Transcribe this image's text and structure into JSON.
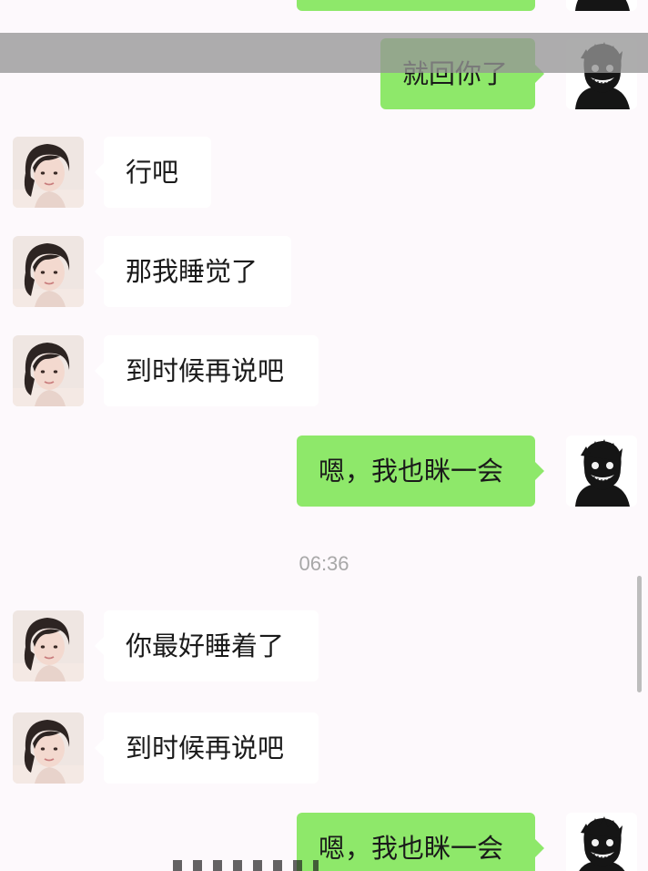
{
  "colors": {
    "background": "#fdf9fc",
    "outgoing_bubble": "#8ee86a",
    "incoming_bubble": "#ffffff",
    "timestamp_text": "#a8a8a8"
  },
  "messages": [
    {
      "side": "right",
      "text": ""
    },
    {
      "side": "right",
      "text": "就回你了"
    },
    {
      "side": "left",
      "text": "行吧"
    },
    {
      "side": "left",
      "text": "那我睡觉了"
    },
    {
      "side": "left",
      "text": "到时候再说吧"
    },
    {
      "side": "right",
      "text": "嗯，我也眯一会"
    },
    {
      "side": "left",
      "text": "你最好睡着了"
    },
    {
      "side": "left",
      "text": "到时候再说吧"
    },
    {
      "side": "right",
      "text": "嗯，我也眯一会"
    }
  ],
  "timestamp": "06:36",
  "icons": {
    "incoming_avatar": "girl-photo-avatar",
    "outgoing_avatar": "dark-grinning-figure-avatar"
  }
}
